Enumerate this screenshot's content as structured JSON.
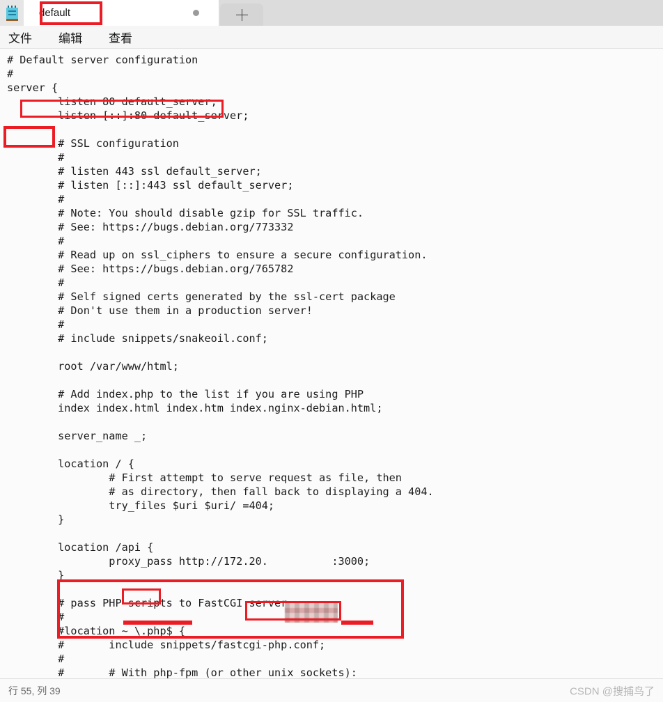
{
  "window": {
    "app_icon": "notepad-icon"
  },
  "tabbar": {
    "active_tab_label": "default",
    "modified_indicator": "●",
    "new_tab_label": "+"
  },
  "menubar": {
    "items": [
      {
        "label": "文件"
      },
      {
        "label": "编辑"
      },
      {
        "label": "查看"
      }
    ]
  },
  "editor": {
    "filename": "default",
    "language": "nginx-conf",
    "content": "# Default server configuration\n#\nserver {\n        listen 80 default_server;\n        listen [::]:80 default_server;\n\n        # SSL configuration\n        #\n        # listen 443 ssl default_server;\n        # listen [::]:443 ssl default_server;\n        #\n        # Note: You should disable gzip for SSL traffic.\n        # See: https://bugs.debian.org/773332\n        #\n        # Read up on ssl_ciphers to ensure a secure configuration.\n        # See: https://bugs.debian.org/765782\n        #\n        # Self signed certs generated by the ssl-cert package\n        # Don't use them in a production server!\n        #\n        # include snippets/snakeoil.conf;\n\n        root /var/www/html;\n\n        # Add index.php to the list if you are using PHP\n        index index.html index.htm index.nginx-debian.html;\n\n        server_name _;\n\n        location / {\n                # First attempt to serve request as file, then\n                # as directory, then fall back to displaying a 404.\n                try_files $uri $uri/ =404;\n        }\n\n        location /api {\n                proxy_pass http://172.20.          :3000;\n        }\n\n        # pass PHP scripts to FastCGI server\n        #\n        #location ~ \\.php$ {\n        #       include snippets/fastcgi-php.conf;\n        #\n        #       # With php-fpm (or other unix sockets):"
  },
  "annotations": {
    "color": "#ec1c24",
    "items": [
      {
        "name": "tab-title-highlight",
        "target": "default",
        "kind": "box"
      },
      {
        "name": "default-server-configuration-highlight",
        "target": "Default server configuration",
        "kind": "box"
      },
      {
        "name": "server-block-highlight",
        "target": "server",
        "kind": "box"
      },
      {
        "name": "api-location-block-highlight",
        "target": "location /api { proxy_pass ... }",
        "kind": "box"
      },
      {
        "name": "api-path-highlight",
        "target": "/api",
        "kind": "box"
      },
      {
        "name": "proxy-pass-underline",
        "target": "proxy_pass",
        "kind": "underline"
      },
      {
        "name": "upstream-ip-highlight",
        "target": "172.20.x.x",
        "kind": "box-blurred"
      },
      {
        "name": "upstream-port-underline",
        "target": "3000",
        "kind": "underline"
      }
    ]
  },
  "statusbar": {
    "cursor_position": "行 55, 列 39",
    "watermark": "CSDN @搜捕鸟了"
  }
}
